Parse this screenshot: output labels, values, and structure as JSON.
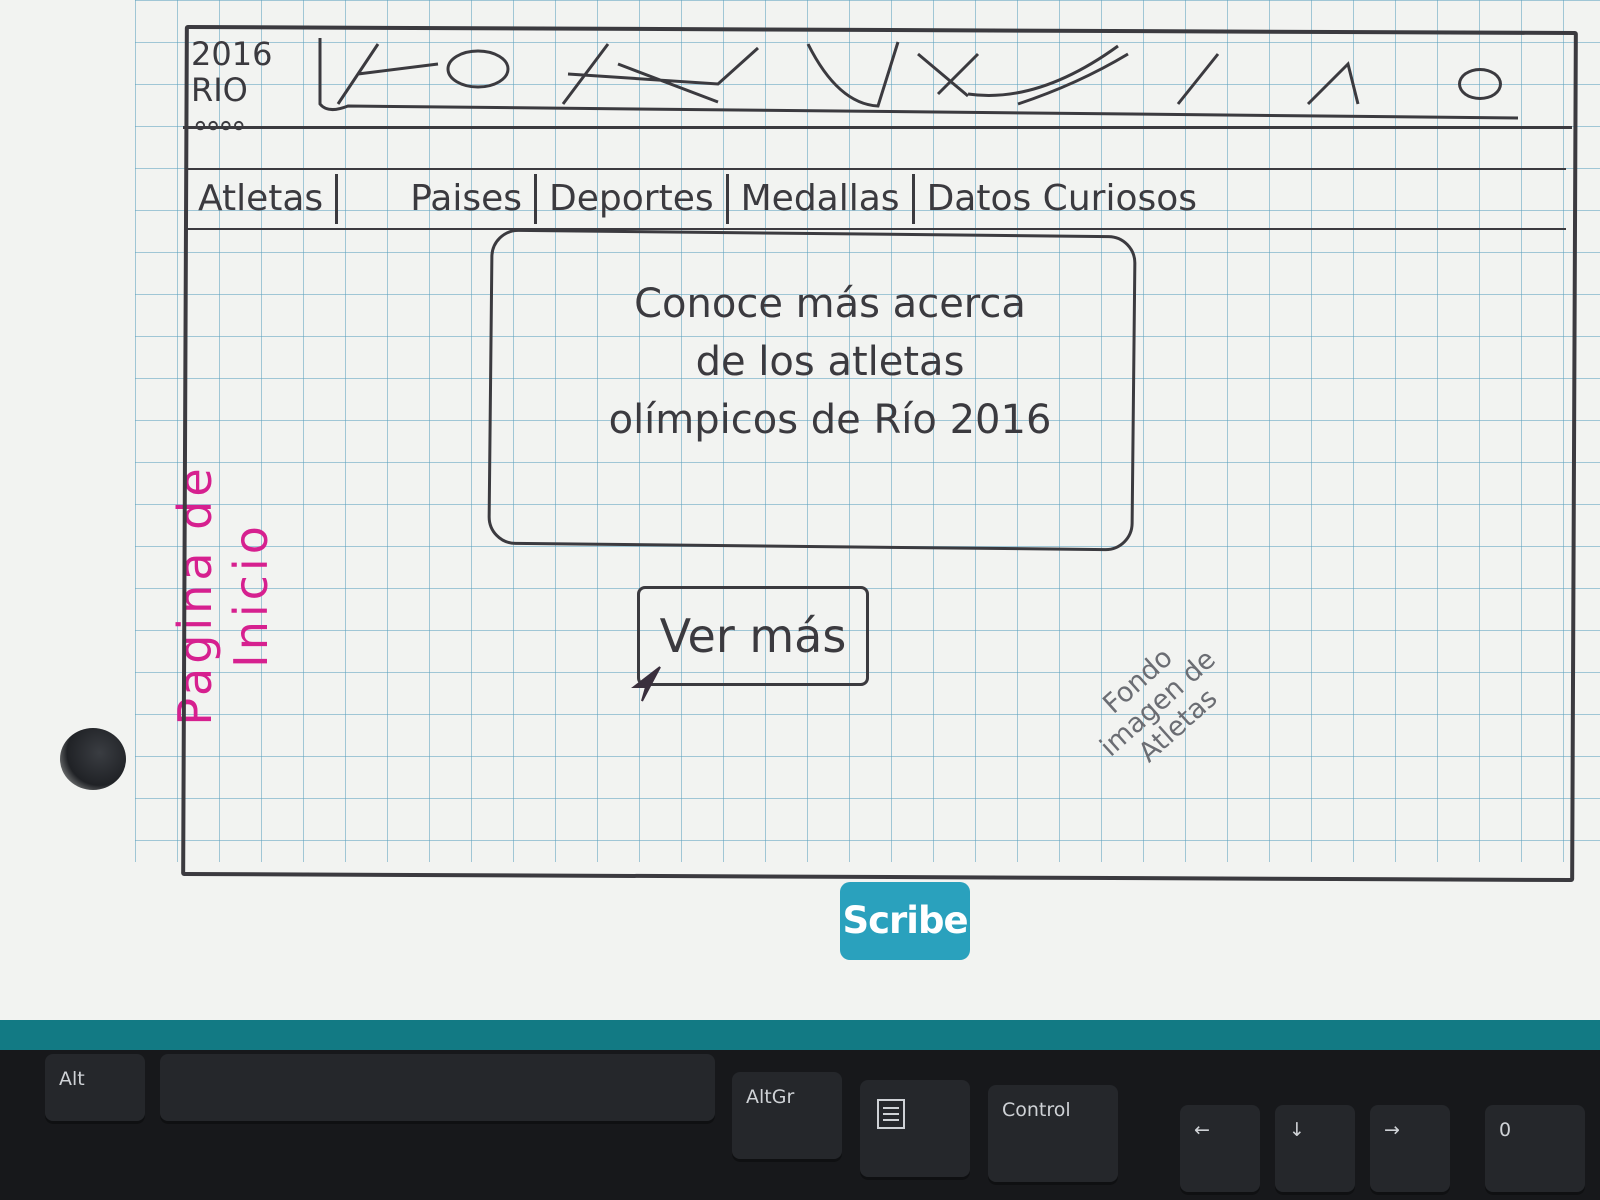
{
  "sheet": {
    "side_label": "Pagina de Inicio"
  },
  "header": {
    "logo_year": "2016",
    "logo_city": "RIO",
    "logo_rings": "∘∘∘∘"
  },
  "nav": {
    "items": [
      "Atletas",
      "Paises",
      "Deportes",
      "Medallas",
      "Datos Curiosos"
    ]
  },
  "hero": {
    "text": "Conoce más acerca\nde los  atletas\nolímpicos de Río 2016"
  },
  "cta": {
    "label": "Ver más"
  },
  "annotation": {
    "background_note": "Fondo\nimagen de\nAtletas"
  },
  "brand": {
    "scribe_logo": "Scribe"
  },
  "keyboard": {
    "keys": [
      "Alt",
      "AltGr",
      "Control",
      "←",
      "↓",
      "→",
      "0"
    ]
  },
  "colors": {
    "ink": "#3b3a3f",
    "pink_label": "#d6208f",
    "grid": "#5ca0be",
    "scribe_teal": "#2aa1bd"
  },
  "icons": {
    "user": "user-circle-icon",
    "cursor": "mouse-pointer-icon",
    "menu_key": "menu-key-icon"
  }
}
